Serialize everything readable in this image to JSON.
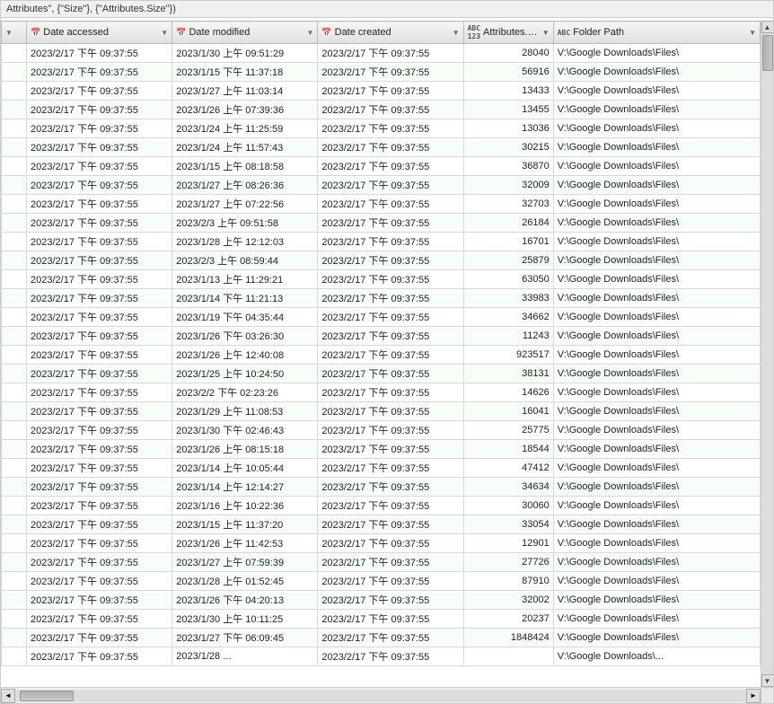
{
  "titleBar": {
    "text": "Attributes\", {\"Size\"}, {\"Attributes.Size\"})"
  },
  "columns": [
    {
      "id": "check",
      "label": "",
      "icon": ""
    },
    {
      "id": "date_accessed",
      "label": "Date accessed",
      "icon": "📅"
    },
    {
      "id": "date_modified",
      "label": "Date modified",
      "icon": "📅"
    },
    {
      "id": "date_created",
      "label": "Date created",
      "icon": "📅"
    },
    {
      "id": "size",
      "label": "Attributes.Size",
      "icon": "123"
    },
    {
      "id": "folder",
      "label": "Folder Path",
      "icon": "ABC"
    }
  ],
  "rows": [
    {
      "date_accessed": "2023/2/17 下午 09:37:55",
      "date_modified": "2023/1/30 上午 09:51:29",
      "date_created": "2023/2/17 下午 09:37:55",
      "size": "28040",
      "folder": "V:\\Google Downloads\\Files\\"
    },
    {
      "date_accessed": "2023/2/17 下午 09:37:55",
      "date_modified": "2023/1/15 下午 11:37:18",
      "date_created": "2023/2/17 下午 09:37:55",
      "size": "56916",
      "folder": "V:\\Google Downloads\\Files\\"
    },
    {
      "date_accessed": "2023/2/17 下午 09:37:55",
      "date_modified": "2023/1/27 上午 11:03:14",
      "date_created": "2023/2/17 下午 09:37:55",
      "size": "13433",
      "folder": "V:\\Google Downloads\\Files\\"
    },
    {
      "date_accessed": "2023/2/17 下午 09:37:55",
      "date_modified": "2023/1/26 上午 07:39:36",
      "date_created": "2023/2/17 下午 09:37:55",
      "size": "13455",
      "folder": "V:\\Google Downloads\\Files\\"
    },
    {
      "date_accessed": "2023/2/17 下午 09:37:55",
      "date_modified": "2023/1/24 上午 11:25:59",
      "date_created": "2023/2/17 下午 09:37:55",
      "size": "13036",
      "folder": "V:\\Google Downloads\\Files\\"
    },
    {
      "date_accessed": "2023/2/17 下午 09:37:55",
      "date_modified": "2023/1/24 上午 11:57:43",
      "date_created": "2023/2/17 下午 09:37:55",
      "size": "30215",
      "folder": "V:\\Google Downloads\\Files\\"
    },
    {
      "date_accessed": "2023/2/17 下午 09:37:55",
      "date_modified": "2023/1/15 上午 08:18:58",
      "date_created": "2023/2/17 下午 09:37:55",
      "size": "36870",
      "folder": "V:\\Google Downloads\\Files\\"
    },
    {
      "date_accessed": "2023/2/17 下午 09:37:55",
      "date_modified": "2023/1/27 上午 08:26:36",
      "date_created": "2023/2/17 下午 09:37:55",
      "size": "32009",
      "folder": "V:\\Google Downloads\\Files\\"
    },
    {
      "date_accessed": "2023/2/17 下午 09:37:55",
      "date_modified": "2023/1/27 上午 07:22:56",
      "date_created": "2023/2/17 下午 09:37:55",
      "size": "32703",
      "folder": "V:\\Google Downloads\\Files\\"
    },
    {
      "date_accessed": "2023/2/17 下午 09:37:55",
      "date_modified": "2023/2/3 上午 09:51:58",
      "date_created": "2023/2/17 下午 09:37:55",
      "size": "26184",
      "folder": "V:\\Google Downloads\\Files\\"
    },
    {
      "date_accessed": "2023/2/17 下午 09:37:55",
      "date_modified": "2023/1/28 上午 12:12:03",
      "date_created": "2023/2/17 下午 09:37:55",
      "size": "16701",
      "folder": "V:\\Google Downloads\\Files\\"
    },
    {
      "date_accessed": "2023/2/17 下午 09:37:55",
      "date_modified": "2023/2/3 上午 08:59:44",
      "date_created": "2023/2/17 下午 09:37:55",
      "size": "25879",
      "folder": "V:\\Google Downloads\\Files\\"
    },
    {
      "date_accessed": "2023/2/17 下午 09:37:55",
      "date_modified": "2023/1/13 上午 11:29:21",
      "date_created": "2023/2/17 下午 09:37:55",
      "size": "63050",
      "folder": "V:\\Google Downloads\\Files\\"
    },
    {
      "date_accessed": "2023/2/17 下午 09:37:55",
      "date_modified": "2023/1/14 下午 11:21:13",
      "date_created": "2023/2/17 下午 09:37:55",
      "size": "33983",
      "folder": "V:\\Google Downloads\\Files\\"
    },
    {
      "date_accessed": "2023/2/17 下午 09:37:55",
      "date_modified": "2023/1/19 下午 04:35:44",
      "date_created": "2023/2/17 下午 09:37:55",
      "size": "34662",
      "folder": "V:\\Google Downloads\\Files\\"
    },
    {
      "date_accessed": "2023/2/17 下午 09:37:55",
      "date_modified": "2023/1/26 下午 03:26:30",
      "date_created": "2023/2/17 下午 09:37:55",
      "size": "11243",
      "folder": "V:\\Google Downloads\\Files\\"
    },
    {
      "date_accessed": "2023/2/17 下午 09:37:55",
      "date_modified": "2023/1/26 上午 12:40:08",
      "date_created": "2023/2/17 下午 09:37:55",
      "size": "923517",
      "folder": "V:\\Google Downloads\\Files\\"
    },
    {
      "date_accessed": "2023/2/17 下午 09:37:55",
      "date_modified": "2023/1/25 上午 10:24:50",
      "date_created": "2023/2/17 下午 09:37:55",
      "size": "38131",
      "folder": "V:\\Google Downloads\\Files\\"
    },
    {
      "date_accessed": "2023/2/17 下午 09:37:55",
      "date_modified": "2023/2/2 下午 02:23:26",
      "date_created": "2023/2/17 下午 09:37:55",
      "size": "14626",
      "folder": "V:\\Google Downloads\\Files\\"
    },
    {
      "date_accessed": "2023/2/17 下午 09:37:55",
      "date_modified": "2023/1/29 上午 11:08:53",
      "date_created": "2023/2/17 下午 09:37:55",
      "size": "16041",
      "folder": "V:\\Google Downloads\\Files\\"
    },
    {
      "date_accessed": "2023/2/17 下午 09:37:55",
      "date_modified": "2023/1/30 下午 02:46:43",
      "date_created": "2023/2/17 下午 09:37:55",
      "size": "25775",
      "folder": "V:\\Google Downloads\\Files\\"
    },
    {
      "date_accessed": "2023/2/17 下午 09:37:55",
      "date_modified": "2023/1/26 上午 08:15:18",
      "date_created": "2023/2/17 下午 09:37:55",
      "size": "18544",
      "folder": "V:\\Google Downloads\\Files\\"
    },
    {
      "date_accessed": "2023/2/17 下午 09:37:55",
      "date_modified": "2023/1/14 上午 10:05:44",
      "date_created": "2023/2/17 下午 09:37:55",
      "size": "47412",
      "folder": "V:\\Google Downloads\\Files\\"
    },
    {
      "date_accessed": "2023/2/17 下午 09:37:55",
      "date_modified": "2023/1/14 上午 12:14:27",
      "date_created": "2023/2/17 下午 09:37:55",
      "size": "34634",
      "folder": "V:\\Google Downloads\\Files\\"
    },
    {
      "date_accessed": "2023/2/17 下午 09:37:55",
      "date_modified": "2023/1/16 上午 10:22:36",
      "date_created": "2023/2/17 下午 09:37:55",
      "size": "30060",
      "folder": "V:\\Google Downloads\\Files\\"
    },
    {
      "date_accessed": "2023/2/17 下午 09:37:55",
      "date_modified": "2023/1/15 上午 11:37:20",
      "date_created": "2023/2/17 下午 09:37:55",
      "size": "33054",
      "folder": "V:\\Google Downloads\\Files\\"
    },
    {
      "date_accessed": "2023/2/17 下午 09:37:55",
      "date_modified": "2023/1/26 上午 11:42:53",
      "date_created": "2023/2/17 下午 09:37:55",
      "size": "12901",
      "folder": "V:\\Google Downloads\\Files\\"
    },
    {
      "date_accessed": "2023/2/17 下午 09:37:55",
      "date_modified": "2023/1/27 上午 07:59:39",
      "date_created": "2023/2/17 下午 09:37:55",
      "size": "27726",
      "folder": "V:\\Google Downloads\\Files\\"
    },
    {
      "date_accessed": "2023/2/17 下午 09:37:55",
      "date_modified": "2023/1/28 上午 01:52:45",
      "date_created": "2023/2/17 下午 09:37:55",
      "size": "87910",
      "folder": "V:\\Google Downloads\\Files\\"
    },
    {
      "date_accessed": "2023/2/17 下午 09:37:55",
      "date_modified": "2023/1/26 下午 04:20:13",
      "date_created": "2023/2/17 下午 09:37:55",
      "size": "32002",
      "folder": "V:\\Google Downloads\\Files\\"
    },
    {
      "date_accessed": "2023/2/17 下午 09:37:55",
      "date_modified": "2023/1/30 上午 10:11:25",
      "date_created": "2023/2/17 下午 09:37:55",
      "size": "20237",
      "folder": "V:\\Google Downloads\\Files\\"
    },
    {
      "date_accessed": "2023/2/17 下午 09:37:55",
      "date_modified": "2023/1/27 下午 06:09:45",
      "date_created": "2023/2/17 下午 09:37:55",
      "size": "1848424",
      "folder": "V:\\Google Downloads\\Files\\"
    },
    {
      "date_accessed": "2023/2/17 下午 09:37:55",
      "date_modified": "2023/1/28 ...",
      "date_created": "2023/2/17 下午 09:37:55",
      "size": "",
      "folder": "V:\\Google Downloads\\..."
    }
  ]
}
